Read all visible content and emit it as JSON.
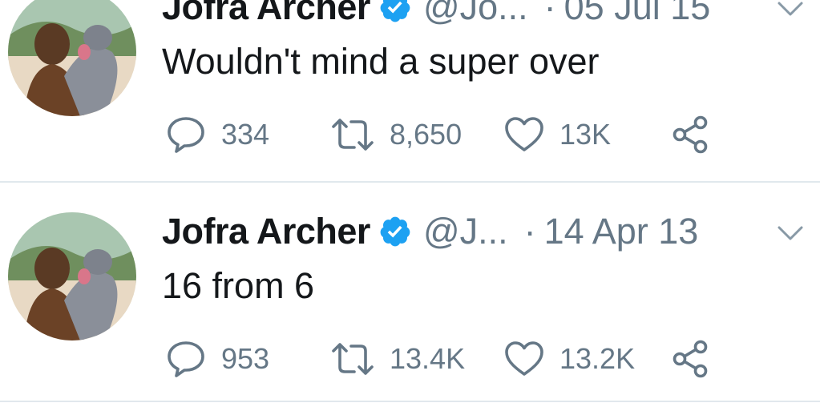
{
  "tweets": [
    {
      "name": "Jofra Archer",
      "handle": "@Jo...",
      "separator": "·",
      "date": "05 Jul 15",
      "text": "Wouldn't mind a super over",
      "replies": "334",
      "retweets": "8,650",
      "likes": "13K"
    },
    {
      "name": "Jofra Archer",
      "handle": "@J...",
      "separator": "·",
      "date": "14 Apr 13",
      "text": "16 from 6",
      "replies": "953",
      "retweets": "13.4K",
      "likes": "13.2K"
    }
  ],
  "colors": {
    "verified": "#1da1f2",
    "muted": "#657786",
    "divider": "#e1e8ed"
  },
  "icons": [
    "verified-badge-icon",
    "chevron-down-icon",
    "reply-icon",
    "retweet-icon",
    "like-icon",
    "share-icon"
  ]
}
